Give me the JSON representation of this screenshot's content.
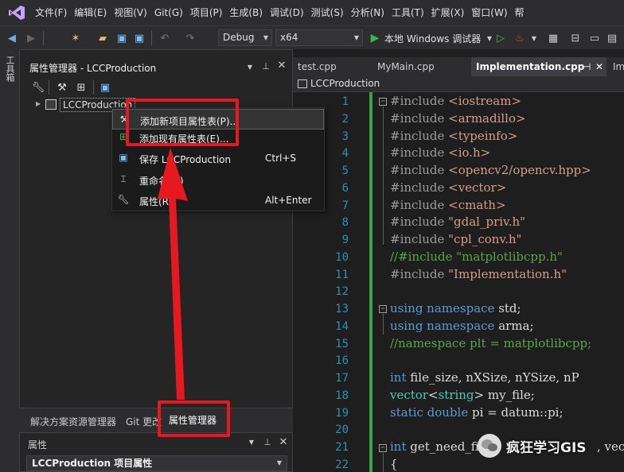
{
  "menubar": {
    "items": [
      "文件(F)",
      "编辑(E)",
      "视图(V)",
      "Git(G)",
      "项目(P)",
      "生成(B)",
      "调试(D)",
      "测试(S)",
      "分析(N)",
      "工具(T)",
      "扩展(X)",
      "窗口(W)",
      "帮"
    ]
  },
  "toolbar": {
    "config": "Debug",
    "platform": "x64",
    "run_label": "本地 Windows 调试器"
  },
  "side_strip": {
    "label": "工具箱"
  },
  "property_manager": {
    "title": "属性管理器 - LCCProduction",
    "tree_project": "LCCProduction"
  },
  "context_menu": {
    "items": [
      {
        "label": "添加新项目属性表(P)...",
        "shortcut": ""
      },
      {
        "label": "添加现有属性表(E)...",
        "shortcut": ""
      },
      {
        "label": "保存 LCCProduction",
        "shortcut": "Ctrl+S"
      },
      {
        "label": "重命名(M)",
        "shortcut": ""
      },
      {
        "label": "属性(R)",
        "shortcut": "Alt+Enter"
      }
    ]
  },
  "bottom_tabs": {
    "solution_explorer": "解决方案资源管理器",
    "git": "Git 更改",
    "property_manager": "属性管理器"
  },
  "properties_panel": {
    "title": "属性",
    "selected": "LCCProduction  项目属性"
  },
  "editor": {
    "tabs": [
      "test.cpp",
      "MyMain.cpp",
      "Implementation.cpp",
      "Im"
    ],
    "nav_scope": "LCCProduction",
    "line_numbers": [
      "1",
      "2",
      "3",
      "4",
      "5",
      "6",
      "7",
      "8",
      "9",
      "10",
      "11",
      "12",
      "13",
      "14",
      "15",
      "16",
      "17",
      "18",
      "19",
      "20",
      "21",
      "22"
    ],
    "code": {
      "l1_a": "#include ",
      "l1_b": "<iostream>",
      "l2_a": "#include ",
      "l2_b": "<armadillo>",
      "l3_a": "#include ",
      "l3_b": "<typeinfo>",
      "l4_a": "#include ",
      "l4_b": "<io.h>",
      "l5_a": "#include ",
      "l5_b": "<opencv2/opencv.hpp>",
      "l6_a": "#include ",
      "l6_b": "<vector>",
      "l7_a": "#include ",
      "l7_b": "<cmath>",
      "l8_a": "#include ",
      "l8_b": "\"gdal_priv.h\"",
      "l9_a": "#include ",
      "l9_b": "\"cpl_conv.h\"",
      "l10": "//#include \"matplotlibcpp.h\"",
      "l11_a": "#include ",
      "l11_b": "\"Implementation.h\"",
      "l13_a": "using namespace",
      "l13_b": " std;",
      "l14_a": "using namespace",
      "l14_b": " arma;",
      "l15": "//namespace plt = matplotlibcpp;",
      "l17_a": "int",
      "l17_b": " file_size, nXSize, nYSize, nP",
      "l18_a": "vector",
      "l18_b": "<",
      "l18_c": "string",
      "l18_d": "> my_file;",
      "l19_a": "static double",
      "l19_b": " pi = datum::pi;",
      "l21_a": "int",
      "l21_b": " get_need_fi",
      "l21_tail": ", vec",
      "l22": "{"
    }
  },
  "watermark": {
    "text": "疯狂学习GIS"
  },
  "colors": {
    "annotation_red": "#e5191f",
    "editor_bg": "#1e1e1e",
    "panel_bg": "#252526",
    "line_number": "#2b91af"
  }
}
